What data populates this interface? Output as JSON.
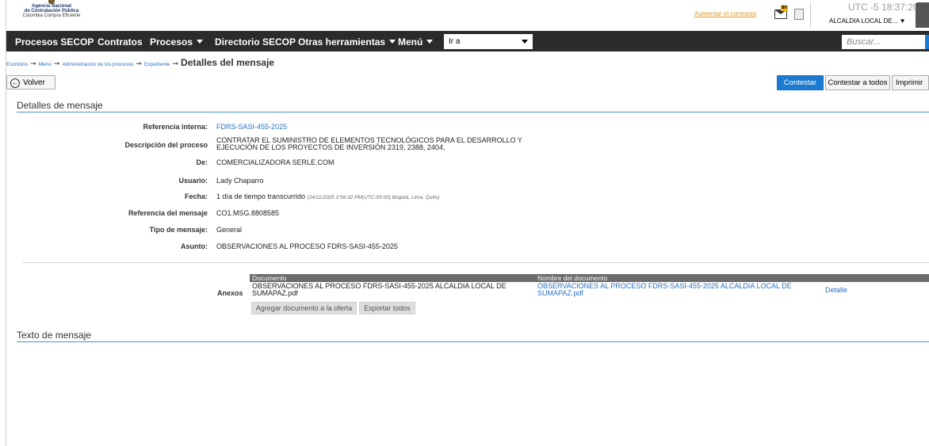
{
  "header": {
    "logo_lines": [
      "Agencia Nacional",
      "de Contratación Pública",
      "Colombia Compra Eficiente"
    ],
    "contrast_link": "Aumentar el contraste",
    "mail_badge": "80",
    "clock": "UTC -5 18:37:20",
    "entity": "ALCALDIA LOCAL DE...",
    "entity_caret": "▼"
  },
  "nav": {
    "items": [
      "Procesos SECOP",
      "Contratos",
      "Procesos",
      "Directorio SECOP",
      "Otras herramientas",
      "Menú"
    ],
    "goto_select": "Ir a",
    "search_placeholder": "Buscar..."
  },
  "breadcrumb": {
    "links": [
      "Escritorio",
      "Menú",
      "Administración de los procesos",
      "Expediente"
    ],
    "separator": "➞",
    "current": "Detalles del mensaje"
  },
  "toolbar": {
    "back_label": "Volver",
    "reply_label": "Contestar",
    "reply_all_label": "Contestar a todos",
    "print_label": "Imprimir"
  },
  "details": {
    "section_title": "Detalles de mensaje",
    "fields": [
      {
        "label": "Referencia interna:",
        "value": "FDRS-SASI-455-2025"
      },
      {
        "label": "Descripción del proceso",
        "value": "CONTRATAR EL SUMINISTRO DE ELEMENTOS TECNOLÓGICOS PARA EL DESARROLLO Y EJECUCIÓN DE LOS PROYECTOS DE INVERSIÓN 2319, 2388, 2404,"
      },
      {
        "label": "De:",
        "value": "COMERCIALIZADORA SERLE.COM"
      },
      {
        "label": "Usuario:",
        "value": "Lady Chaparro"
      },
      {
        "label": "Fecha:",
        "value": "1 día de tiempo transcurrido",
        "timestamp": "(24/11/2025 2:56:32 PM(UTC-05:00) Bogotá, Lima, Quito)"
      },
      {
        "label": "Referencia del mensaje",
        "value": "CO1.MSG.8808585"
      },
      {
        "label": "Tipo de mensaje:",
        "value": "General"
      },
      {
        "label": "Asunto:",
        "value": "OBSERVACIONES AL PROCESO FDRS-SASI-455-2025"
      }
    ]
  },
  "attachments": {
    "label": "Anexos",
    "columns": [
      "Documento",
      "Nombre del documento"
    ],
    "rows": [
      {
        "document": "OBSERVACIONES AL PROCESO FDRS-SASI-455-2025 ALCALDIA LOCAL DE SUMAPAZ.pdf",
        "name": "OBSERVACIONES AL PROCESO FDRS-SASI-455-2025 ALCALDIA LOCAL DE SUMAPAZ.pdf",
        "action": "Detalle"
      }
    ],
    "add_button": "Agregar documento a la oferta",
    "export_button": "Exportar todos"
  },
  "message": {
    "section_title": "Texto de mensaje"
  }
}
